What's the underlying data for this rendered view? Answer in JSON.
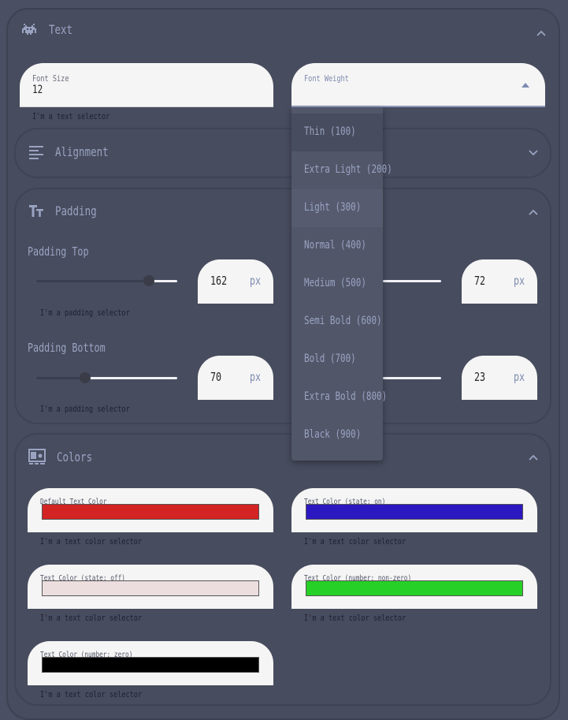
{
  "colors": {
    "page_bg": "#4a4f63",
    "accent": "#9aa3c2",
    "field_bg": "#f5f5f5",
    "helper_text": "#1e2130"
  },
  "text_section": {
    "title": "Text",
    "icon": "space-invader-icon",
    "expanded": true,
    "font_size": {
      "label": "Font Size",
      "value": "12",
      "helper": "I'm a text selector"
    },
    "font_weight": {
      "label": "Font Weight",
      "value": "",
      "options": [
        "Thin (100)",
        "Extra Light (200)",
        "Light (300)",
        "Normal (400)",
        "Medium (500)",
        "Semi Bold (600)",
        "Bold (700)",
        "Extra Bold (800)",
        "Black (900)"
      ],
      "dropdown_open": true
    }
  },
  "alignment_section": {
    "title": "Alignment",
    "icon": "align-left-icon",
    "expanded": false
  },
  "padding_section": {
    "title": "Padding",
    "icon": "text-size-icon",
    "expanded": true,
    "padding_top": {
      "label": "Padding Top",
      "value": "162",
      "unit": "px",
      "slider_fraction": 0.8,
      "helper": "I'm a padding selector"
    },
    "padding_right": {
      "value": "72",
      "unit": "px"
    },
    "padding_bottom": {
      "label": "Padding Bottom",
      "value": "70",
      "unit": "px",
      "slider_fraction": 0.35,
      "helper": "I'm a padding selector"
    },
    "padding_left": {
      "value": "23",
      "unit": "px"
    }
  },
  "colors_section": {
    "title": "Colors",
    "icon": "color-palette-icon",
    "expanded": true,
    "items": [
      {
        "label": "Default Text Color",
        "color": "#d32323",
        "helper": "I'm a text color selector"
      },
      {
        "label": "Text Color (state: on)",
        "color": "#2c18c0",
        "helper": "I'm a text color selector"
      },
      {
        "label": "Text Color (state: off)",
        "color": "#ecdede",
        "helper": "I'm a text color selector"
      },
      {
        "label": "Text Color (number: non-zero)",
        "color": "#26d026",
        "helper": "I'm a text color selector"
      },
      {
        "label": "Text Color (number: zero)",
        "color": "#000000",
        "helper": "I'm a text color selector"
      }
    ]
  }
}
